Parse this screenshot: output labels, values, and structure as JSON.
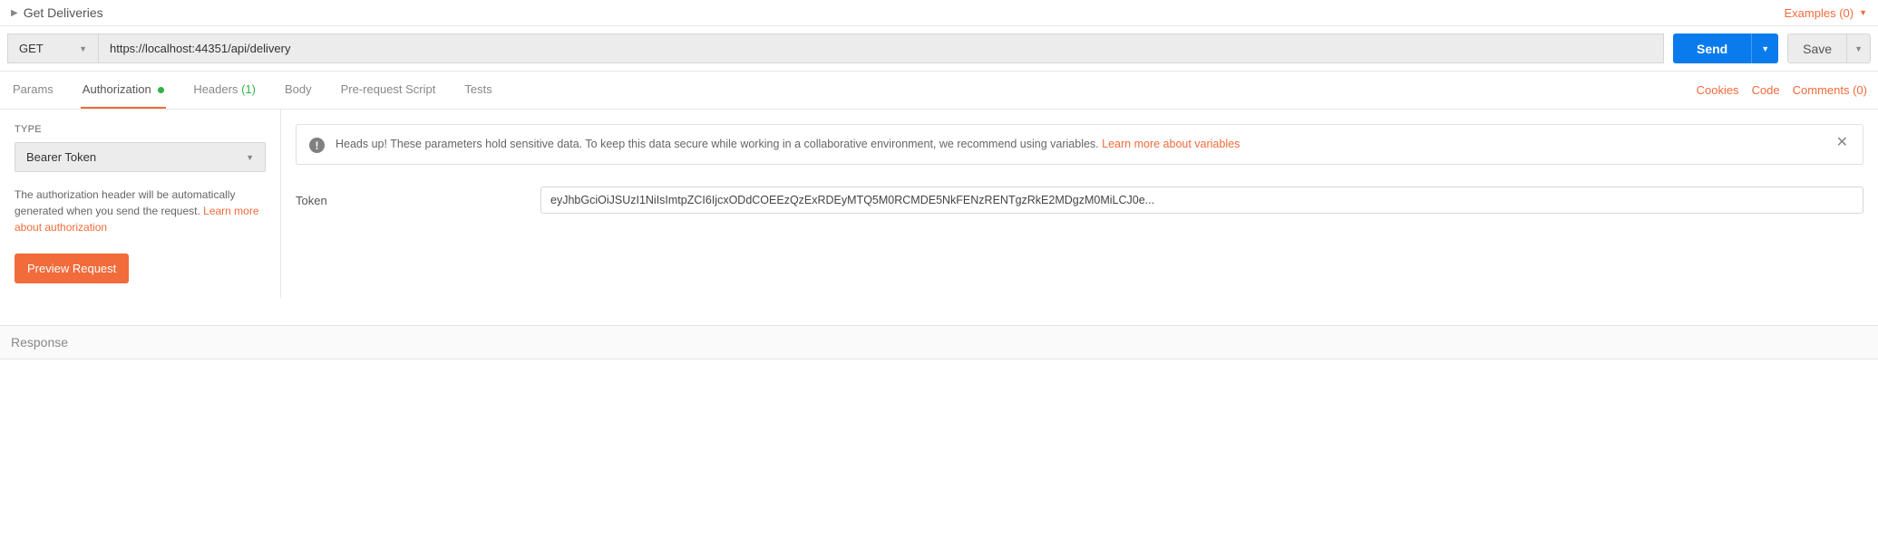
{
  "request": {
    "name": "Get Deliveries",
    "method": "GET",
    "url": "https://localhost:44351/api/delivery"
  },
  "header": {
    "examples_label": "Examples (0)"
  },
  "actions": {
    "send": "Send",
    "save": "Save"
  },
  "tabs": {
    "params": "Params",
    "authorization": "Authorization",
    "headers": "Headers",
    "headers_count": "(1)",
    "body": "Body",
    "prerequest": "Pre-request Script",
    "tests": "Tests"
  },
  "links": {
    "cookies": "Cookies",
    "code": "Code",
    "comments": "Comments (0)"
  },
  "auth": {
    "type_label": "TYPE",
    "type_value": "Bearer Token",
    "description_pre": "The authorization header will be automatically generated when you send the request. ",
    "description_link": "Learn more about authorization",
    "preview_button": "Preview Request",
    "warning_text": "Heads up! These parameters hold sensitive data. To keep this data secure while working in a collaborative environment, we recommend using variables. ",
    "warning_link": "Learn more about variables",
    "token_label": "Token",
    "token_value": "eyJhbGciOiJSUzI1NiIsImtpZCI6IjcxODdCOEEzQzExRDEyMTQ5M0RCMDE5NkFENzRENTgzRkE2MDgzM0MiLCJ0e..."
  },
  "response": {
    "label": "Response"
  }
}
